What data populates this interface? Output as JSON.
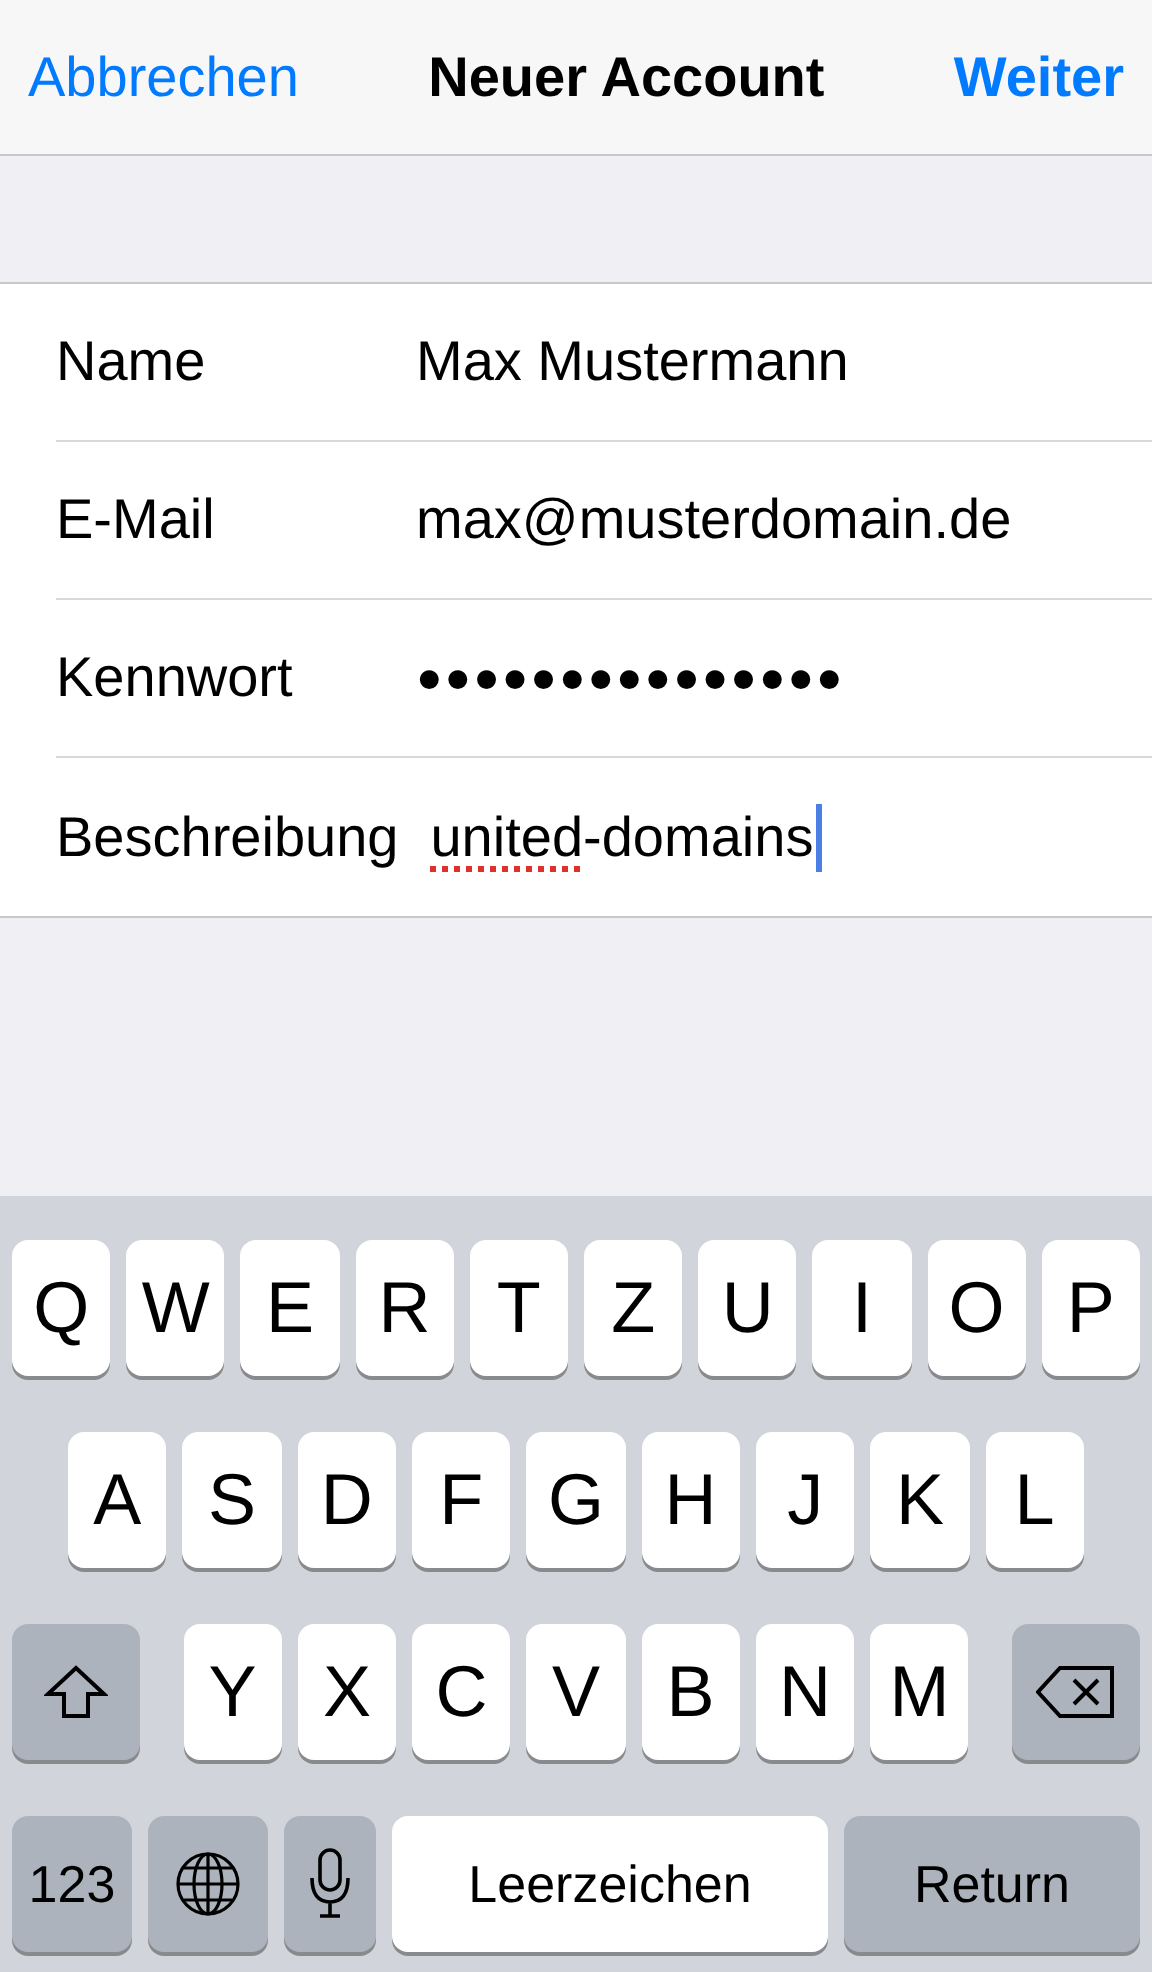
{
  "nav": {
    "cancel": "Abbrechen",
    "title": "Neuer Account",
    "next": "Weiter"
  },
  "fields": [
    {
      "label": "Name",
      "kind": "text",
      "value": "Max Mustermann",
      "focused": false
    },
    {
      "label": "E-Mail",
      "kind": "text",
      "value": "max@musterdomain.de",
      "focused": false
    },
    {
      "label": "Kennwort",
      "kind": "password",
      "value": "●●●●●●●●●●●●●●●",
      "focused": false
    },
    {
      "label": "Beschreibung",
      "kind": "spell",
      "parts": [
        {
          "text": "united",
          "misspelled": true
        },
        {
          "text": "-domains",
          "misspelled": false
        }
      ],
      "focused": true
    }
  ],
  "keyboard": {
    "key_rows": [
      {
        "keys": [
          {
            "kind": "char",
            "label": "Q"
          },
          {
            "kind": "char",
            "label": "W"
          },
          {
            "kind": "char",
            "label": "E"
          },
          {
            "kind": "char",
            "label": "R"
          },
          {
            "kind": "char",
            "label": "T"
          },
          {
            "kind": "char",
            "label": "Z"
          },
          {
            "kind": "char",
            "label": "U"
          },
          {
            "kind": "char",
            "label": "I"
          },
          {
            "kind": "char",
            "label": "O"
          },
          {
            "kind": "char",
            "label": "P"
          }
        ]
      },
      {
        "keys": [
          {
            "kind": "char",
            "label": "A"
          },
          {
            "kind": "char",
            "label": "S"
          },
          {
            "kind": "char",
            "label": "D"
          },
          {
            "kind": "char",
            "label": "F"
          },
          {
            "kind": "char",
            "label": "G"
          },
          {
            "kind": "char",
            "label": "H"
          },
          {
            "kind": "char",
            "label": "J"
          },
          {
            "kind": "char",
            "label": "K"
          },
          {
            "kind": "char",
            "label": "L"
          }
        ]
      },
      {
        "keys": [
          {
            "kind": "shift"
          },
          {
            "kind": "char",
            "label": "Y"
          },
          {
            "kind": "char",
            "label": "X"
          },
          {
            "kind": "char",
            "label": "C"
          },
          {
            "kind": "char",
            "label": "V"
          },
          {
            "kind": "char",
            "label": "B"
          },
          {
            "kind": "char",
            "label": "N"
          },
          {
            "kind": "char",
            "label": "M"
          },
          {
            "kind": "backspace"
          }
        ]
      },
      {
        "keys": [
          {
            "kind": "mode",
            "label": "123"
          },
          {
            "kind": "globe"
          },
          {
            "kind": "mic"
          },
          {
            "kind": "space",
            "label": "Leerzeichen"
          },
          {
            "kind": "return",
            "label": "Return"
          }
        ]
      }
    ]
  }
}
